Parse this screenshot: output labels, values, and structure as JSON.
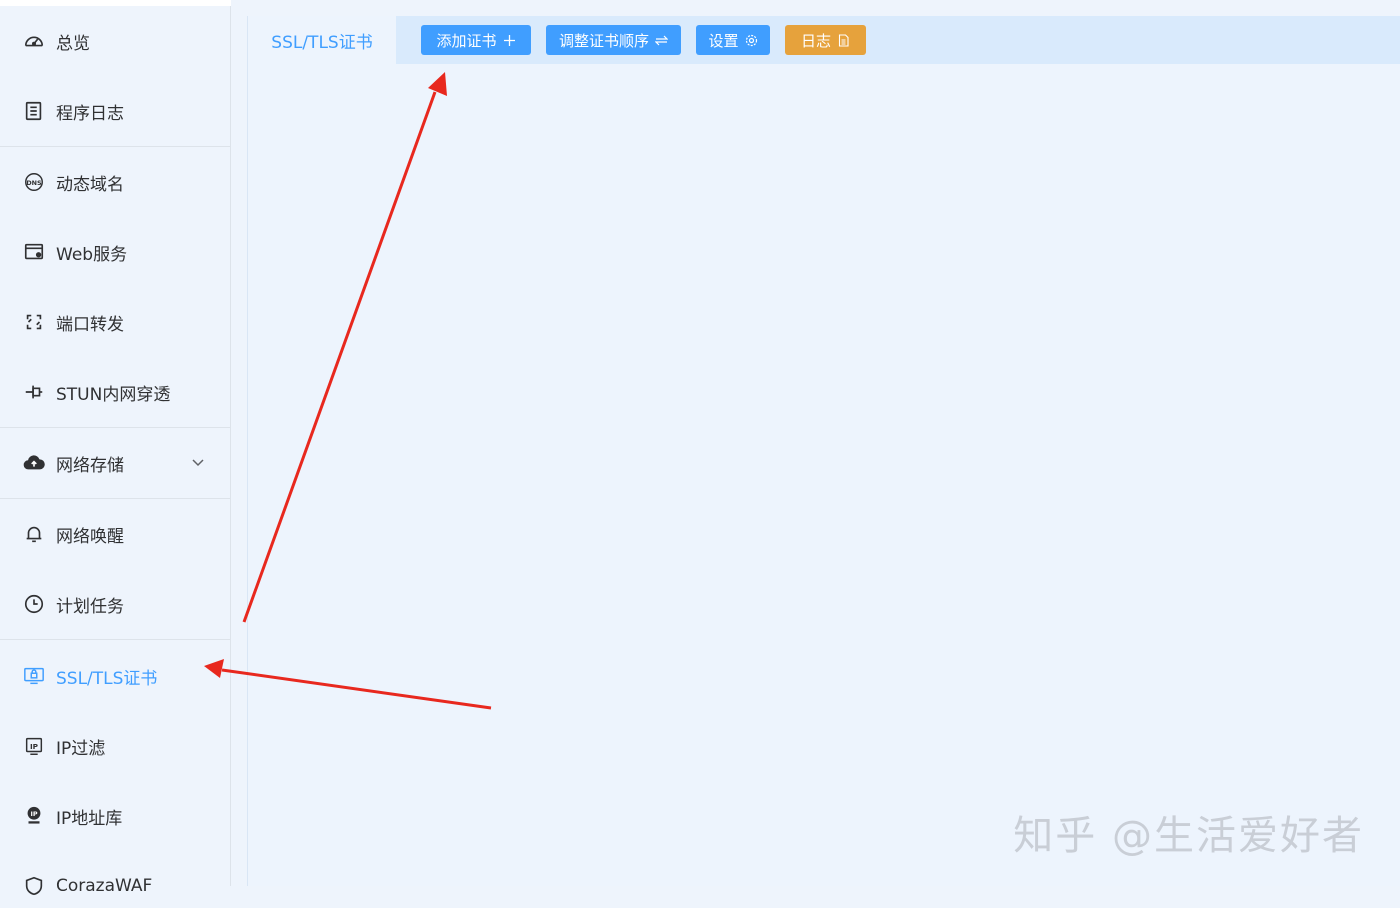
{
  "sidebar": {
    "items": [
      {
        "label": "总览",
        "icon": "dashboard-icon"
      },
      {
        "label": "程序日志",
        "icon": "log-document-icon"
      },
      {
        "label": "动态域名",
        "icon": "dns-icon"
      },
      {
        "label": "Web服务",
        "icon": "web-service-icon"
      },
      {
        "label": "端口转发",
        "icon": "port-forward-icon"
      },
      {
        "label": "STUN内网穿透",
        "icon": "stun-icon"
      },
      {
        "label": "网络存储",
        "icon": "cloud-upload-icon"
      },
      {
        "label": "网络唤醒",
        "icon": "bell-icon"
      },
      {
        "label": "计划任务",
        "icon": "clock-icon"
      },
      {
        "label": "SSL/TLS证书",
        "icon": "certificate-icon"
      },
      {
        "label": "IP过滤",
        "icon": "ip-filter-icon"
      },
      {
        "label": "IP地址库",
        "icon": "ip-database-icon"
      },
      {
        "label": "CorazaWAF",
        "icon": "shield-icon"
      }
    ],
    "active": "SSL/TLS证书"
  },
  "main": {
    "tab_label": "SSL/TLS证书",
    "buttons": {
      "add_cert": "添加证书",
      "reorder": "调整证书顺序",
      "settings": "设置",
      "log": "日志"
    },
    "colors": {
      "primary": "#409eff",
      "warning": "#e6a23c",
      "annotation_arrow": "#e8281e"
    }
  },
  "watermark": "知乎 @生活爱好者"
}
